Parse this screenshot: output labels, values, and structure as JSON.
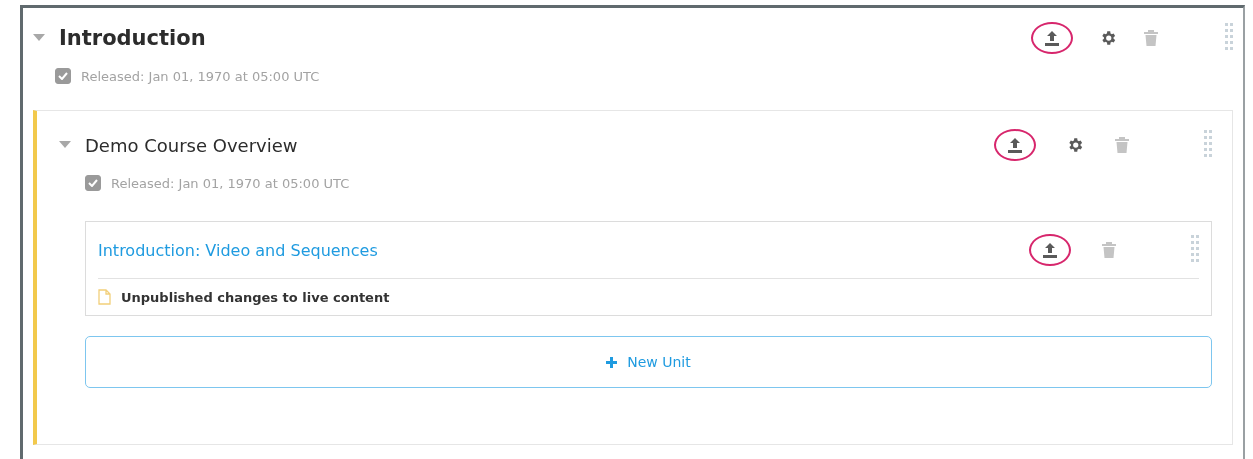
{
  "section": {
    "title": "Introduction",
    "expanded": true,
    "released": {
      "checked": true,
      "text": "Released: Jan 01, 1970 at 05:00 UTC"
    },
    "subsection": {
      "title": "Demo Course Overview",
      "expanded": true,
      "released": {
        "checked": true,
        "text": "Released: Jan 01, 1970 at 05:00 UTC"
      },
      "units": [
        {
          "title": "Introduction: Video and Sequences",
          "status": "Unpublished changes to live content"
        }
      ],
      "new_unit_button": "New Unit"
    }
  }
}
